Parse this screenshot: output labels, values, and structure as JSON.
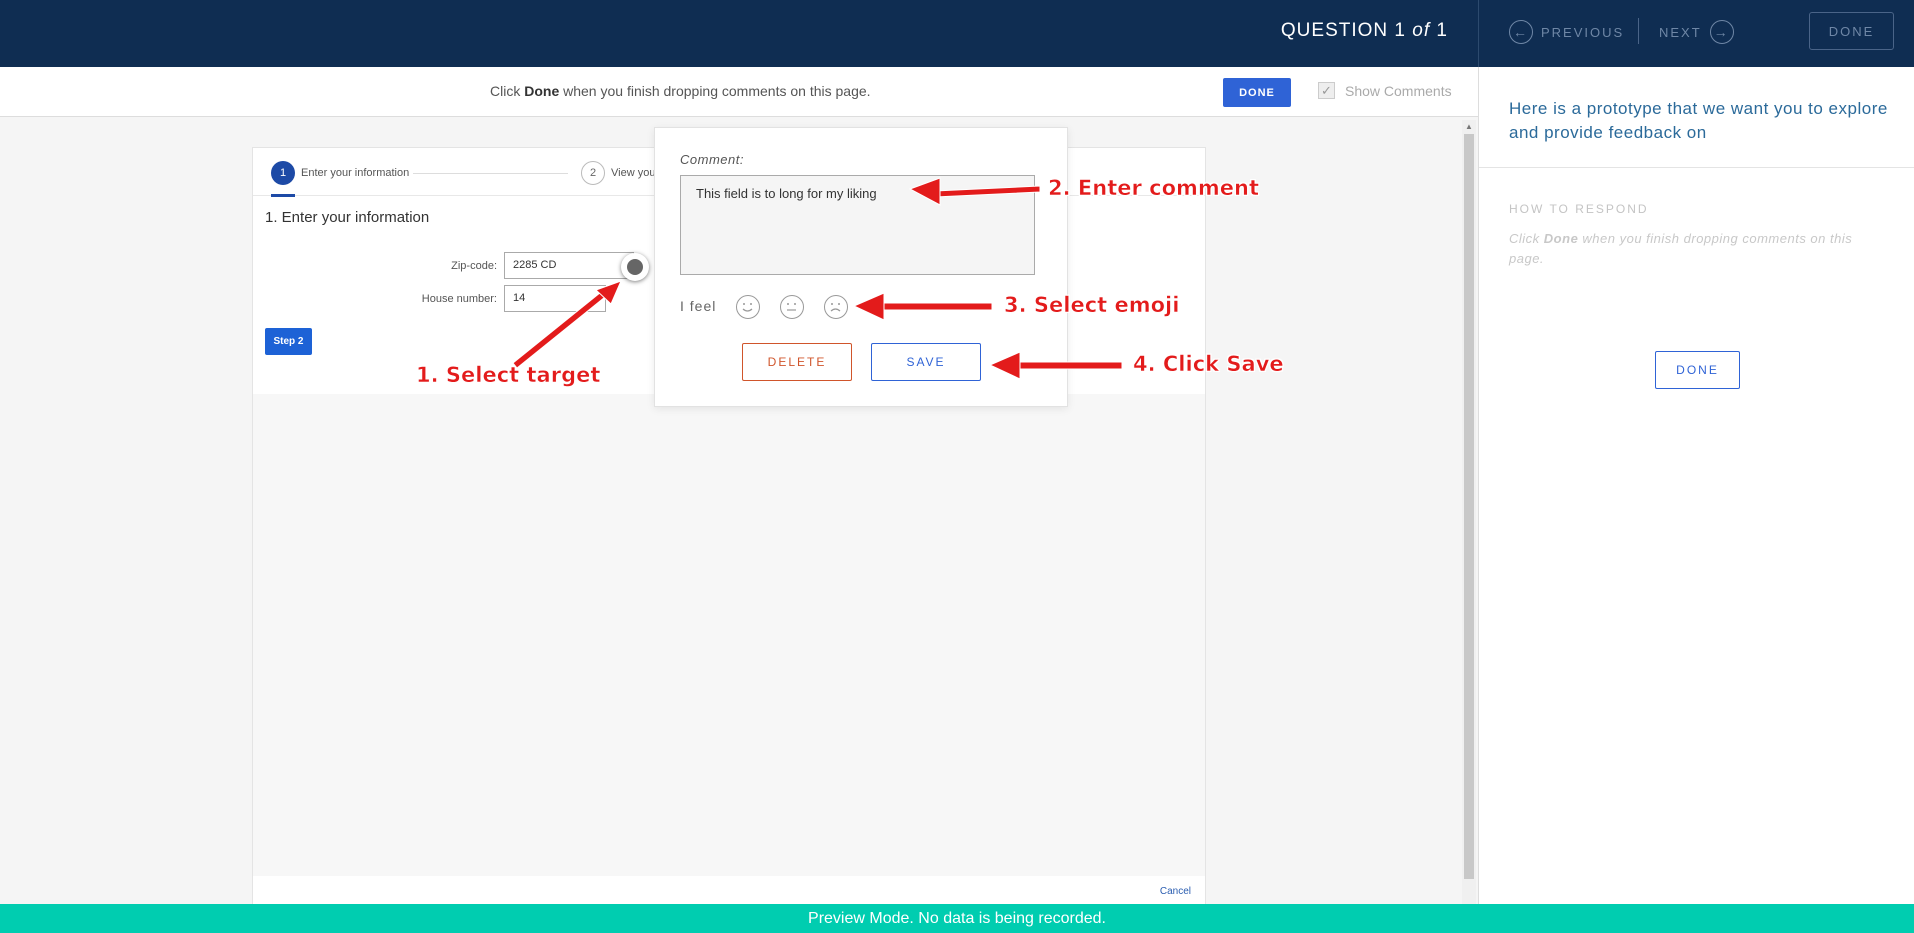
{
  "header": {
    "question_prefix": "QUESTION",
    "question_current": "1",
    "question_of": "of",
    "question_total": "1",
    "previous_label": "PREVIOUS",
    "next_label": "NEXT",
    "done_label": "DONE"
  },
  "subbar": {
    "hint_pre": "Click",
    "hint_bold": "Done",
    "hint_post": "when you finish dropping comments on this page.",
    "done_label": "DONE",
    "show_comments_label": "Show Comments",
    "show_comments_checked": true
  },
  "prototype": {
    "steps": [
      {
        "number": "1",
        "label": "Enter your information"
      },
      {
        "number": "2",
        "label": "View your"
      }
    ],
    "form_title": "1. Enter your information",
    "zip_label": "Zip-code:",
    "zip_value": "2285 CD",
    "house_label": "House number:",
    "house_value": "14",
    "step2_button": "Step 2",
    "cancel_label": "Cancel"
  },
  "comment_popover": {
    "label": "Comment:",
    "text": "This field is to long for my liking",
    "feel_label": "I feel",
    "emojis": [
      "happy-emoji",
      "neutral-emoji",
      "sad-emoji"
    ],
    "delete_label": "DELETE",
    "save_label": "SAVE"
  },
  "right_panel": {
    "intro": "Here is a prototype that we want you to explore and provide feedback on",
    "how_to_respond": "HOW TO RESPOND",
    "hint_pre": "Click",
    "hint_bold": "Done",
    "hint_post": "when you finish dropping comments on this page.",
    "done_label": "DONE"
  },
  "annotations": {
    "a1": "1. Select target",
    "a2": "2. Enter comment",
    "a3": "3. Select emoji",
    "a4": "4. Click Save"
  },
  "footer": {
    "text": "Preview Mode. No data is being recorded."
  },
  "colors": {
    "header_bg": "#0f2d52",
    "primary_blue": "#2f63d6",
    "delete_orange": "#d0552b",
    "footer_teal": "#00cdb0",
    "annotation_red": "#e31b1b"
  }
}
